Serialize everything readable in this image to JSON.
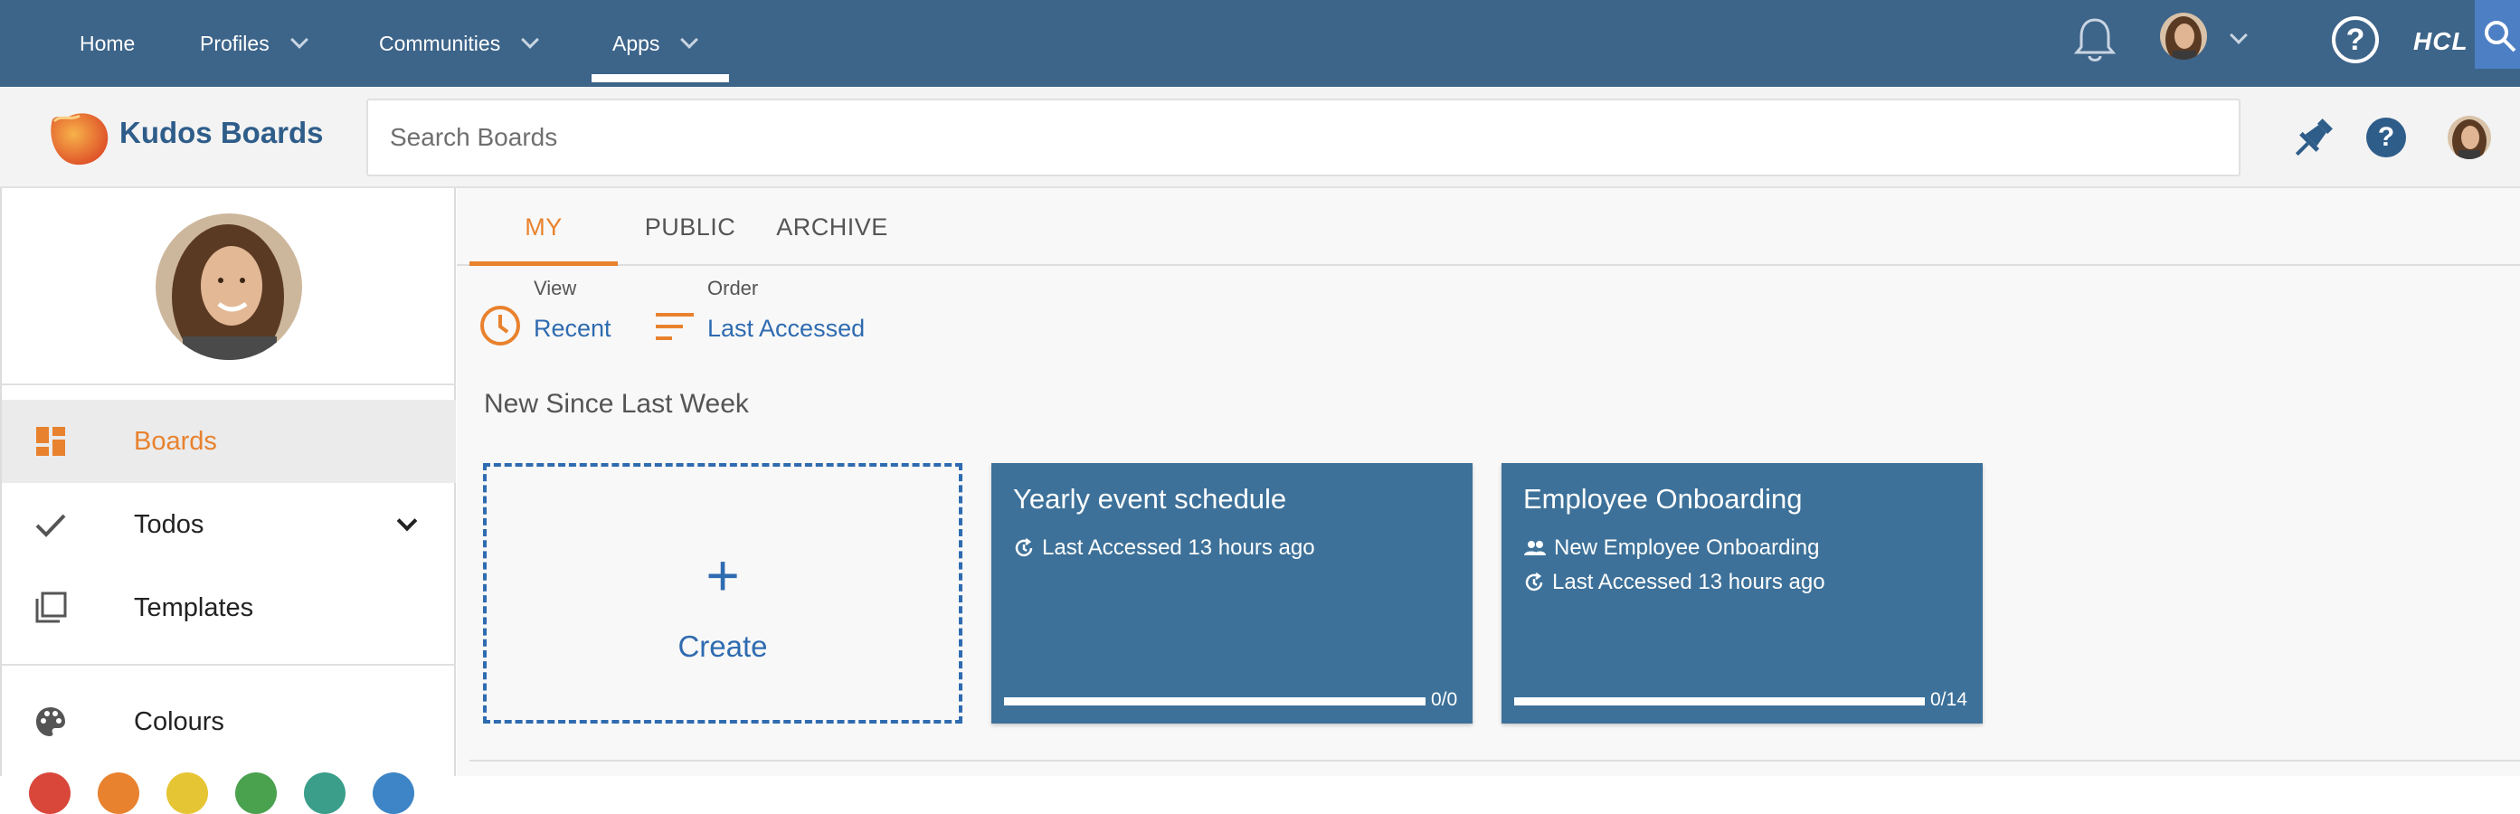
{
  "topnav": {
    "items": [
      {
        "label": "Home"
      },
      {
        "label": "Profiles"
      },
      {
        "label": "Communities"
      },
      {
        "label": "Apps"
      }
    ],
    "brand": "HCL",
    "color": "#3d6489"
  },
  "header": {
    "app_title": "Kudos Boards",
    "search_placeholder": "Search Boards"
  },
  "sidebar": {
    "items": [
      {
        "label": "Boards",
        "icon": "dashboard-icon",
        "active": true
      },
      {
        "label": "Todos",
        "icon": "check-icon"
      },
      {
        "label": "Templates",
        "icon": "templates-icon"
      },
      {
        "label": "Colours",
        "icon": "palette-icon"
      }
    ],
    "colour_swatches": [
      "#d9473b",
      "#e8822e",
      "#e6c534",
      "#4aa14e",
      "#3a9e8a",
      "#3d85c6"
    ]
  },
  "main": {
    "tabs": [
      {
        "label": "MY",
        "active": true
      },
      {
        "label": "PUBLIC"
      },
      {
        "label": "ARCHIVE"
      }
    ],
    "view": {
      "label": "View",
      "value": "Recent"
    },
    "order": {
      "label": "Order",
      "value": "Last Accessed"
    },
    "section_title": "New Since Last Week",
    "create_label": "Create",
    "create_plus": "+",
    "cards": [
      {
        "title": "Yearly event schedule",
        "lines": [
          "Last Accessed 13 hours ago"
        ],
        "count": "0/0",
        "progress": 0
      },
      {
        "title": "Employee Onboarding",
        "lines": [
          "New Employee Onboarding",
          "Last Accessed 13 hours ago"
        ],
        "count": "0/14",
        "progress": 0
      }
    ],
    "accent_color": "#e8822e",
    "link_color": "#2f6bb0",
    "card_color": "#3d7199"
  }
}
